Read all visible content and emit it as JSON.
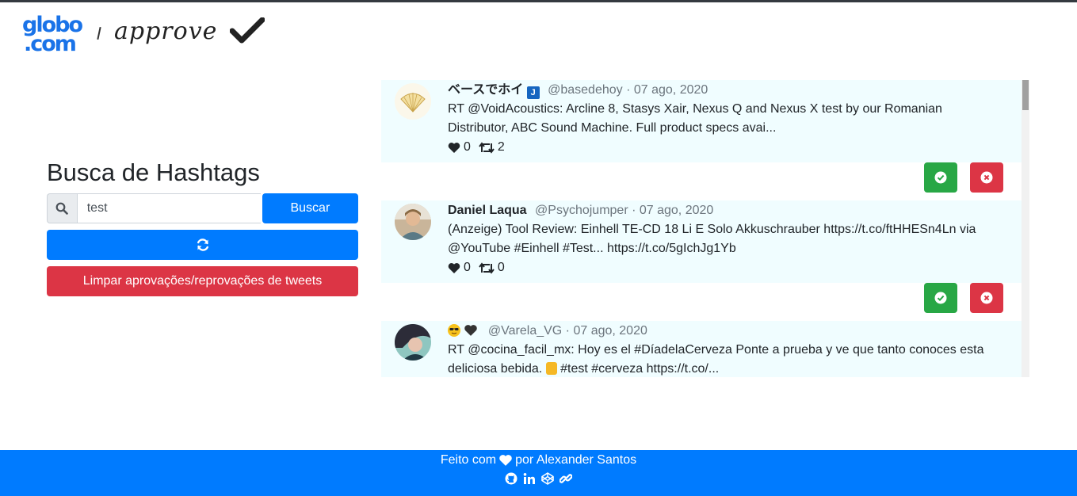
{
  "brand": {
    "logo_line1": "globo",
    "logo_line2": ".com",
    "app_name": "approve",
    "brand_color": "#1a73e8"
  },
  "search": {
    "title": "Busca de Hashtags",
    "query": "test",
    "search_icon": "search-icon",
    "button_label": "Buscar",
    "refresh_icon": "refresh-icon",
    "clear_label": "Limpar aprovações/reprovações de tweets"
  },
  "tweets": [
    {
      "name": "ベースでホイ",
      "badge_glyph": "J",
      "handle": "@basedehoy · 07 ago, 2020",
      "text": "RT @VoidAcoustics: Arcline 8, Stasys Xair, Nexus Q and Nexus X test by our Romanian Distributor, ABC Sound Machine. Full product specs avai...",
      "likes": "0",
      "retweets": "2"
    },
    {
      "name": "Daniel Laqua",
      "handle": "@Psychojumper · 07 ago, 2020",
      "text": "(Anzeige) Tool Review: Einhell TE-CD 18 Li E Solo Akkuschrauber https://t.co/ftHHESn4Ln via @YouTube #Einhell #Test... https://t.co/5gIchJg1Yb",
      "likes": "0",
      "retweets": "0"
    },
    {
      "name_emojis": [
        "sunglasses-emoji",
        "black-heart-emoji"
      ],
      "handle": "@Varela_VG · 07 ago, 2020",
      "text_part1": "RT @cocina_facil_mx: Hoy es el #DíadelaCerveza Ponte a prueba y ve que tanto conoces esta deliciosa bebida.",
      "text_part2": "#test #cerveza https://t.co/..."
    }
  ],
  "colors": {
    "primary": "#007bff",
    "danger": "#dc3545",
    "success": "#28a745",
    "tweet_bg": "#f0fdff"
  },
  "footer": {
    "made_with": "Feito com",
    "by": "por Alexander Santos",
    "icons": [
      "github-icon",
      "linkedin-icon",
      "codepen-icon",
      "link-icon"
    ]
  }
}
